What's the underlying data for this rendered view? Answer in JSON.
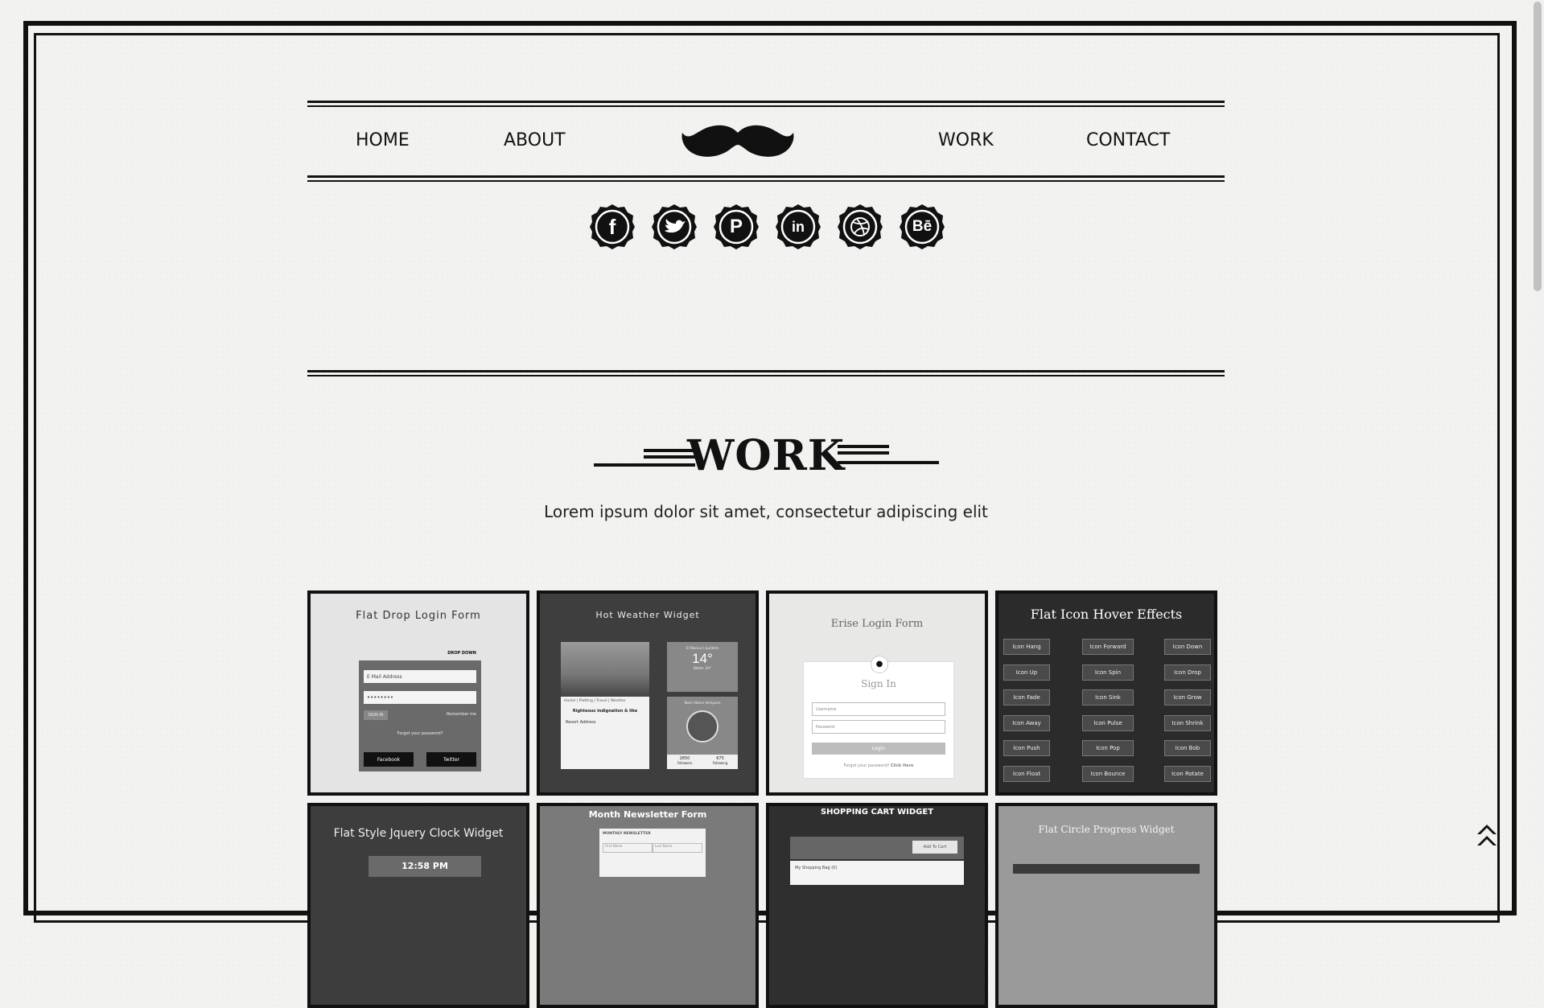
{
  "nav": {
    "home": "HOME",
    "about": "ABOUT",
    "work": "WORK",
    "contact": "CONTACT"
  },
  "social": [
    {
      "name": "facebook",
      "glyph": "f"
    },
    {
      "name": "twitter",
      "glyph": "🐦"
    },
    {
      "name": "pinterest",
      "glyph": "P"
    },
    {
      "name": "linkedin",
      "glyph": "in"
    },
    {
      "name": "dribbble",
      "glyph": "⊛"
    },
    {
      "name": "behance",
      "glyph": "Bē"
    }
  ],
  "section": {
    "title": "WORK",
    "lead": "Lorem ipsum dolor sit amet, consectetur adipiscing elit"
  },
  "works": {
    "w1": {
      "title": "Flat Drop Login Form",
      "drop": "DROP DOWN",
      "email_placeholder": "E Mail Address",
      "password_value": "••••••••",
      "signin": "SIGN IN",
      "remember": "Remember me",
      "forgot": "Forgot your password?",
      "facebook": "Facebook",
      "twitter": "Twitter"
    },
    "w2": {
      "title": "Hot Weather Widget",
      "location": "El Naruvri quidem",
      "temp": "14°",
      "sub": "Water 20°",
      "menu": "Hostel | Plotting | Travel | Weather",
      "post_title": "Righteous indignation & like",
      "resort": "Resort Address",
      "user": "Nam libero tempore",
      "followers_n": "2850",
      "followers_l": "Followers",
      "following_n": "675",
      "following_l": "Following"
    },
    "w3": {
      "title": "Erise Login Form",
      "signin": "Sign In",
      "username": "Username",
      "password": "Password",
      "login": "Login",
      "forgot": "Forgot your password?",
      "click": "Click Here"
    },
    "w4": {
      "title": "Flat Icon Hover Effects",
      "buttons": [
        "Icon Hang",
        "Icon Forward",
        "Icon Down",
        "Icon Up",
        "Icon Spin",
        "Icon Drop",
        "Icon Fade",
        "Icon Sink",
        "Icon Grow",
        "Icon Away",
        "Icon Pulse",
        "Icon Shrink",
        "Icon Push",
        "Icon Pop",
        "Icon Bob",
        "Icon Float",
        "Icon Bounce",
        "Icon Rotate"
      ]
    },
    "w5": {
      "title": "Flat Style Jquery Clock Widget",
      "time": "12:58 PM"
    },
    "w6": {
      "title": "Month Newsletter Form",
      "sub": "MONTHLY NEWSLETTER",
      "first": "First Name",
      "last": "Last Name"
    },
    "w7": {
      "title": "SHOPPING CART WIDGET",
      "add": "Add To Cart",
      "bag": "My Shopping Bag (0)"
    },
    "w8": {
      "title": "Flat Circle Progress Widget"
    }
  },
  "colors": {
    "ink": "#111111",
    "paper": "#f2f2f0"
  }
}
